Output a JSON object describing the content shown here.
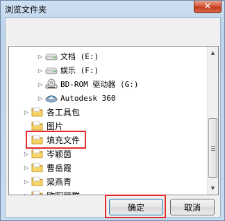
{
  "window": {
    "title": "浏览文件夹",
    "close_symbol": "✕"
  },
  "tree": {
    "items": [
      {
        "label": "文档 (E:)",
        "icon": "drive-icon",
        "expander": "▷",
        "kind": "drive"
      },
      {
        "label": "娱乐 (F:)",
        "icon": "drive-icon",
        "expander": "▷",
        "kind": "drive"
      },
      {
        "label": "BD-ROM 驱动器 (G:)",
        "icon": "optical-drive-icon",
        "expander": "▷",
        "kind": "optical"
      },
      {
        "label": "Autodesk 360",
        "icon": "cloud-icon",
        "expander": "▷",
        "kind": "cloud"
      },
      {
        "label": "各工具包",
        "icon": "folder-icon",
        "expander": "▷",
        "kind": "folder"
      },
      {
        "label": "图片",
        "icon": "folder-icon",
        "expander": "",
        "kind": "folder"
      },
      {
        "label": "填充文件",
        "icon": "folder-icon",
        "expander": "",
        "kind": "folder",
        "highlighted": true
      },
      {
        "label": "岑颖茵",
        "icon": "folder-icon",
        "expander": "▷",
        "kind": "folder"
      },
      {
        "label": "曹岳霞",
        "icon": "folder-icon",
        "expander": "▷",
        "kind": "folder"
      },
      {
        "label": "梁燕青",
        "icon": "folder-icon",
        "expander": "▷",
        "kind": "folder"
      },
      {
        "label": "欧阳丽群",
        "icon": "folder-icon",
        "expander": "▷",
        "kind": "folder"
      }
    ]
  },
  "buttons": {
    "ok_label": "确定",
    "cancel_label": "取消"
  },
  "colors": {
    "highlight_border": "#e32b2b",
    "folder_yellow": "#f3c84a"
  }
}
